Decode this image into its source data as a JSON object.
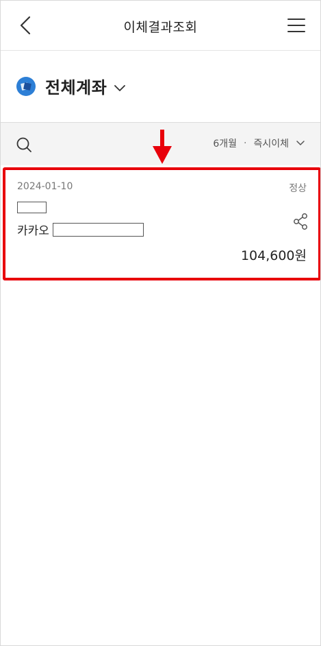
{
  "header": {
    "title": "이체결과조회"
  },
  "account": {
    "name": "전체계좌"
  },
  "filter": {
    "period": "6개월",
    "separator": "·",
    "type": "즉시이체"
  },
  "transactions": [
    {
      "date": "2024-01-10",
      "status": "정상",
      "recipient": "카카오",
      "amount": "104,600원"
    }
  ],
  "colors": {
    "highlight": "#e8000b",
    "bank_logo": "#2d7fd6",
    "filter_bg": "#f4f4f4"
  },
  "icons": {
    "back": "chevron-left-icon",
    "menu": "hamburger-menu-icon",
    "bank": "bank-logo-icon",
    "account_dropdown": "chevron-down-icon",
    "search": "search-icon",
    "filter_dropdown": "chevron-down-icon",
    "share": "share-icon",
    "annotation": "arrow-down-icon"
  }
}
